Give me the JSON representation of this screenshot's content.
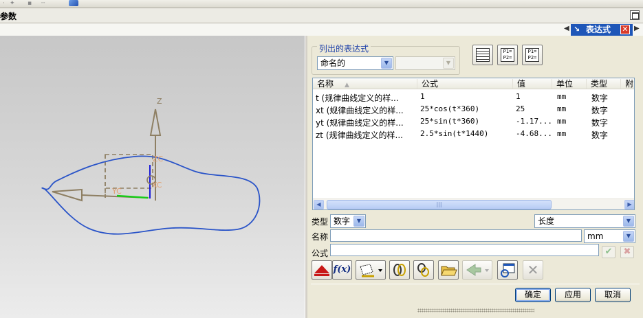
{
  "window": {
    "title": "参数"
  },
  "dock_tab": {
    "label": "表达式",
    "close_glyph": "✕"
  },
  "viewport": {
    "axis_labels": {
      "z": "Z",
      "zc": "ZC",
      "yc": "YC",
      "xc": "XC"
    },
    "colors": {
      "curve": "#2a54c8",
      "axis": "#8e7f63",
      "y_axis": "#18cc18",
      "x_axis": "#1a1ad8"
    }
  },
  "panel": {
    "group_title": "列出的表达式",
    "filter_select": {
      "value": "命名的"
    },
    "filter_select2": {
      "value": ""
    },
    "table": {
      "headers": {
        "name": "名称",
        "formula": "公式",
        "value": "值",
        "unit": "单位",
        "type": "类型",
        "extra": "附"
      },
      "rows": [
        {
          "name": "t  (规律曲线定义的样...",
          "formula": "1",
          "value": "1",
          "unit": "mm",
          "type": "数字"
        },
        {
          "name": "xt  (规律曲线定义的样...",
          "formula": "25*cos(t*360)",
          "value": "25",
          "unit": "mm",
          "type": "数字"
        },
        {
          "name": "yt  (规律曲线定义的样...",
          "formula": "25*sin(t*360)",
          "value": "-1.17...",
          "unit": "mm",
          "type": "数字"
        },
        {
          "name": "zt  (规律曲线定义的样...",
          "formula": "2.5*sin(t*1440)",
          "value": "-4.68...",
          "unit": "mm",
          "type": "数字"
        }
      ]
    },
    "type_label": "类型",
    "type_select": {
      "value": "数字"
    },
    "dimension_select": {
      "value": "长度"
    },
    "name_label": "名称",
    "name_input": {
      "value": ""
    },
    "unit_select": {
      "value": "mm"
    },
    "formula_label": "公式",
    "formula_input": {
      "value": ""
    },
    "toolbar_icons": [
      "function-icon",
      "measure-icon",
      "link-icon",
      "chain-icon",
      "open-folder-icon",
      "arrow-icon",
      "window-icon",
      "delete-icon"
    ],
    "buttons": {
      "ok": "确定",
      "apply": "应用",
      "cancel": "取消"
    }
  }
}
